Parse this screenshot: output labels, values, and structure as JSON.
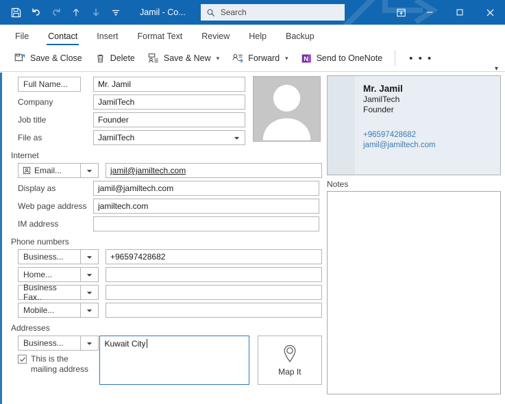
{
  "window": {
    "title": "Jamil  -  Co...",
    "quick_access": [
      {
        "name": "save-icon",
        "label": "Save"
      },
      {
        "name": "undo-icon",
        "label": "Undo"
      },
      {
        "name": "redo-icon",
        "label": "Redo"
      },
      {
        "name": "previous-item-icon",
        "label": "Previous Item"
      },
      {
        "name": "next-item-icon",
        "label": "Next Item"
      },
      {
        "name": "customize-quick-access-icon",
        "label": "Customize Quick Access Toolbar"
      }
    ],
    "controls": {
      "ribbon_display_options": "Ribbon Display Options",
      "minimize": "Minimize",
      "maximize": "Maximize",
      "close": "Close"
    }
  },
  "search": {
    "placeholder": "Search"
  },
  "ribbon": {
    "tabs": [
      {
        "label": "File",
        "active": false
      },
      {
        "label": "Contact",
        "active": true
      },
      {
        "label": "Insert",
        "active": false
      },
      {
        "label": "Format Text",
        "active": false
      },
      {
        "label": "Review",
        "active": false
      },
      {
        "label": "Help",
        "active": false
      },
      {
        "label": "Backup",
        "active": false
      }
    ],
    "commands": [
      {
        "label": "Save & Close",
        "icon": "save-close-icon",
        "dropdown": false
      },
      {
        "label": "Delete",
        "icon": "trash-icon",
        "dropdown": false
      },
      {
        "label": "Save & New",
        "icon": "save-new-icon",
        "dropdown": true
      },
      {
        "label": "Forward",
        "icon": "forward-contact-icon",
        "dropdown": true
      },
      {
        "label": "Send to OneNote",
        "icon": "onenote-icon",
        "dropdown": false
      }
    ],
    "overflow": "• • •",
    "collapse": "Collapse the Ribbon"
  },
  "form": {
    "name_fields": [
      {
        "label": "Full Name...",
        "type": "button",
        "value": "Mr. Jamil",
        "dropdown": false
      },
      {
        "label": "Company",
        "type": "label",
        "value": "JamilTech",
        "dropdown": false
      },
      {
        "label": "Job title",
        "type": "label",
        "value": "Founder",
        "dropdown": false
      },
      {
        "label": "File as",
        "type": "label",
        "value": "JamilTech",
        "dropdown": true
      }
    ],
    "internet": {
      "section": "Internet",
      "rows": [
        {
          "label": "Email...",
          "type": "button",
          "icon": "contact-card-icon",
          "value": "jamil@jamiltech.com",
          "link": true
        },
        {
          "label": "Display as",
          "type": "label",
          "value": "jamil@jamiltech.com",
          "link": false
        },
        {
          "label": "Web page address",
          "type": "label",
          "value": "jamiltech.com",
          "link": false
        },
        {
          "label": "IM address",
          "type": "label",
          "value": "",
          "link": false
        }
      ]
    },
    "phones": {
      "section": "Phone numbers",
      "rows": [
        {
          "label": "Business...",
          "value": "+96597428682"
        },
        {
          "label": "Home...",
          "value": ""
        },
        {
          "label": "Business Fax..",
          "value": ""
        },
        {
          "label": "Mobile...",
          "value": ""
        }
      ]
    },
    "addresses": {
      "section": "Addresses",
      "type_label": "Business...",
      "value": "Kuwait City",
      "checkbox": {
        "label": "This is the\nmailing address",
        "line1": "This is the",
        "line2": "mailing address",
        "checked": true
      },
      "map_button": {
        "label": "Map It",
        "icon": "map-pin-icon"
      }
    },
    "photo": {
      "name": "contact-photo-placeholder"
    }
  },
  "card": {
    "name": "Mr. Jamil",
    "company": "JamilTech",
    "title": "Founder",
    "phone": "+96597428682",
    "email": "jamil@jamiltech.com",
    "link_color": "#3e7bb0"
  },
  "notes": {
    "label": "Notes",
    "value": ""
  },
  "colors": {
    "titlebar": "#1267b2",
    "accent": "#2a7ab9",
    "card_bg": "#e8eef3"
  }
}
